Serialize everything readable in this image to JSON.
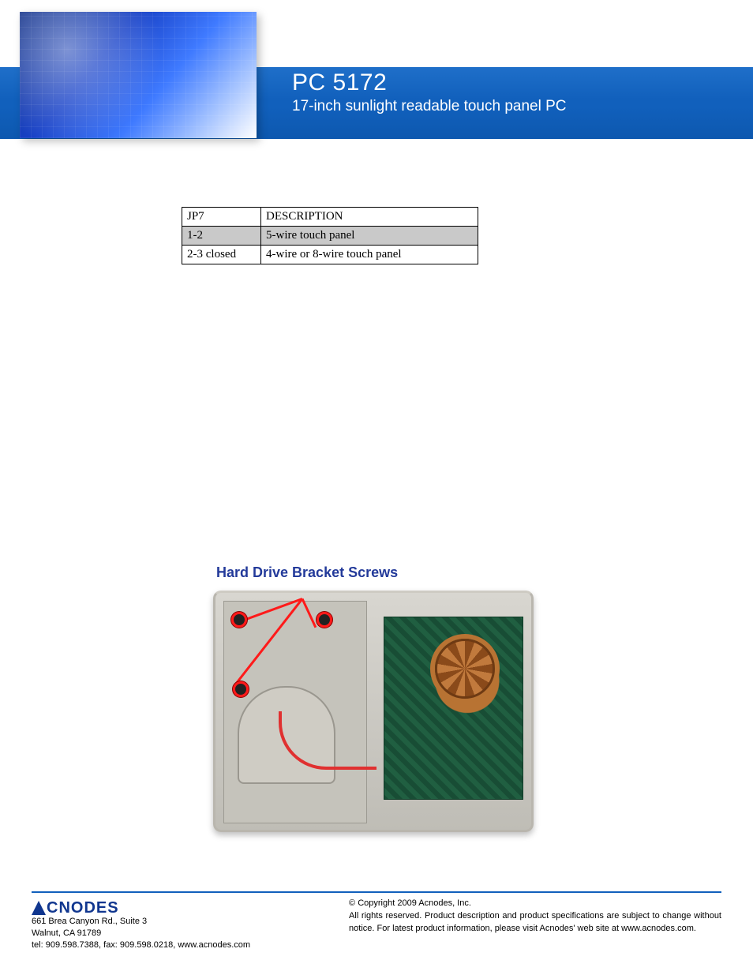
{
  "header": {
    "title": "PC 5172",
    "subtitle": "17-inch sunlight readable touch panel PC"
  },
  "jumper_table": {
    "headers": [
      "JP7",
      "DESCRIPTION"
    ],
    "rows": [
      {
        "col1": "1-2",
        "col2": "5-wire touch panel",
        "shaded": true
      },
      {
        "col1": "2-3 closed",
        "col2": "4-wire or 8-wire touch panel",
        "shaded": false
      }
    ]
  },
  "hdd": {
    "title": "Hard Drive Bracket Screws"
  },
  "footer": {
    "logo_text": "CNODES",
    "address_line1": "661 Brea Canyon Rd., Suite 3",
    "address_line2": "Walnut, CA 91789",
    "contact": "tel: 909.598.7388, fax: 909.598.0218, www.acnodes.com",
    "copyright": "© Copyright 2009 Acnodes, Inc.",
    "disclaimer": "All rights reserved. Product description and product specifications are subject to change without notice. For latest product information, please visit Acnodes' web site at www.acnodes.com."
  }
}
